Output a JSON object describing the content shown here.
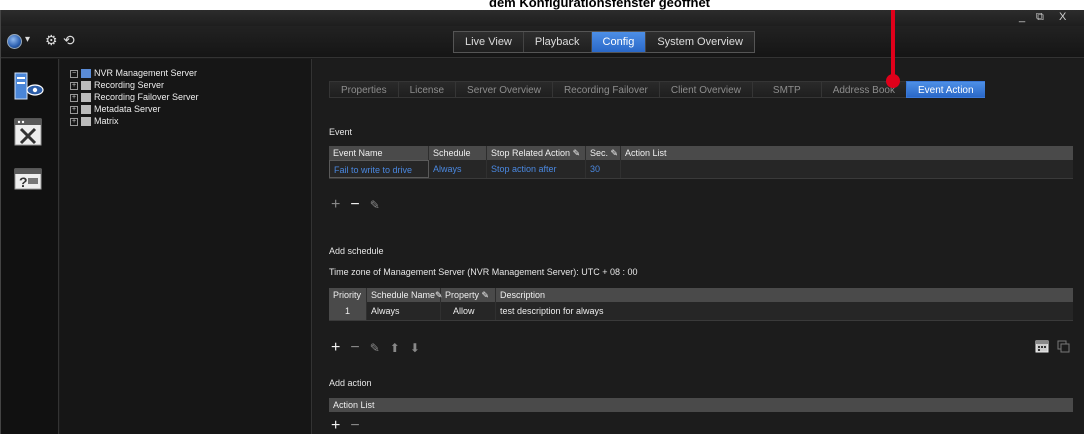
{
  "caption": {
    "text": "dem Konfigurationsfenster geöffnet"
  },
  "window_controls": {
    "minimize": "_",
    "restore": "⧉",
    "close": "X"
  },
  "mode_tabs": [
    {
      "label": "Live View"
    },
    {
      "label": "Playback"
    },
    {
      "label": "Config",
      "active": true
    },
    {
      "label": "System Overview"
    }
  ],
  "tree": {
    "root": "NVR Management Server",
    "children": [
      "Recording Server",
      "Recording Failover Server",
      "Metadata Server",
      "Matrix"
    ]
  },
  "sub_tabs": [
    {
      "label": "Properties"
    },
    {
      "label": "License"
    },
    {
      "label": "Server Overview"
    },
    {
      "label": "Recording Failover"
    },
    {
      "label": "Client Overview"
    },
    {
      "label": "SMTP"
    },
    {
      "label": "Address Book"
    },
    {
      "label": "Event Action",
      "active": true
    }
  ],
  "event": {
    "label": "Event",
    "columns": [
      "Event Name",
      "Schedule",
      "Stop Related Action",
      "Sec.",
      "Action List"
    ],
    "rows": [
      {
        "event_name": "Fail to write to drive",
        "schedule": "Always",
        "stop_related_action": "Stop action after",
        "sec": "30",
        "action_list": ""
      }
    ]
  },
  "schedule": {
    "label": "Add schedule",
    "timezone": "Time zone of Management Server (NVR Management Server): UTC + 08 : 00",
    "columns": [
      "Priority",
      "Schedule Name",
      "Property",
      "Description"
    ],
    "rows": [
      {
        "priority": "1",
        "schedule_name": "Always",
        "property": "Allow",
        "description": "test description for always"
      }
    ]
  },
  "action": {
    "label": "Add action",
    "columns": [
      "Action List"
    ]
  },
  "icons": {
    "add": "plus-icon",
    "remove": "minus-icon",
    "edit": "pencil-icon",
    "up": "arrow-up-icon",
    "down": "arrow-down-icon",
    "calendar": "calendar-icon",
    "copy": "copy-icon"
  },
  "colors": {
    "accent": "#3a78d8",
    "link_blue": "#4a88e0",
    "annotation_red": "#e0001a"
  }
}
